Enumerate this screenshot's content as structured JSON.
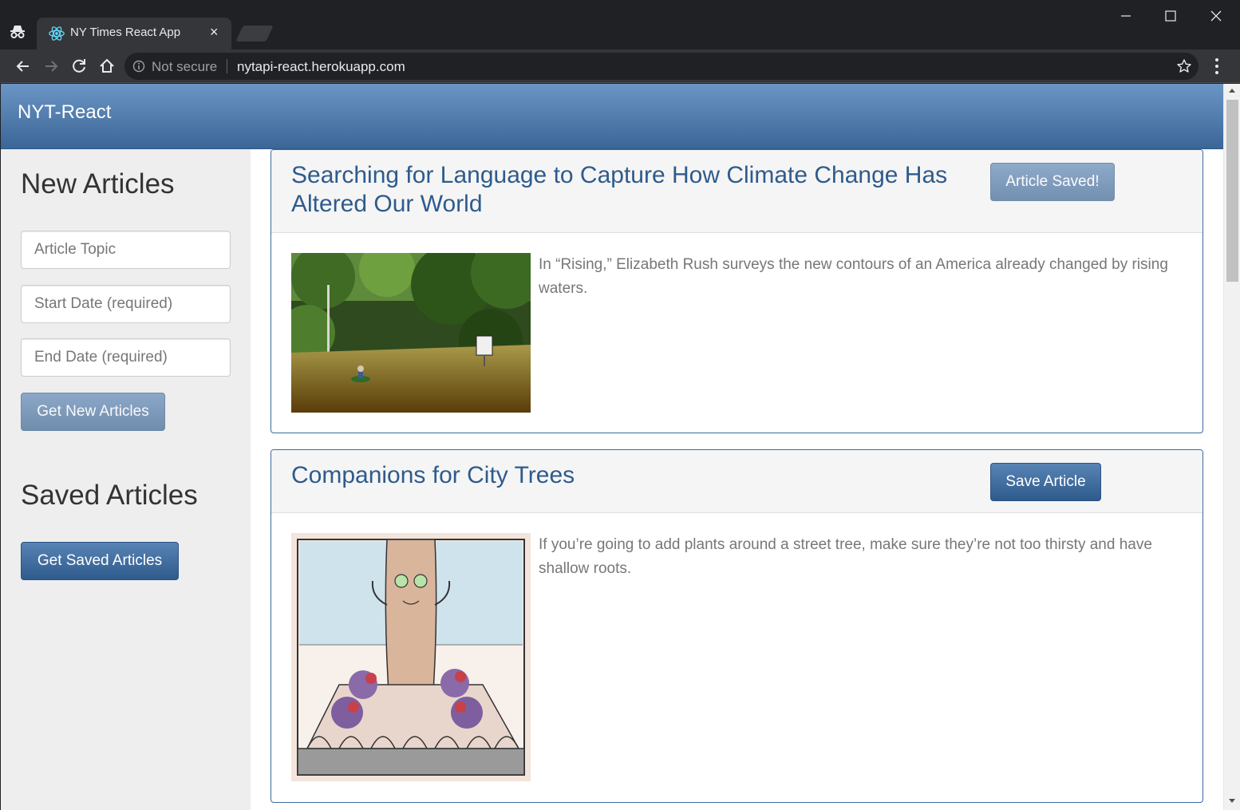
{
  "browser": {
    "tab_title": "NY Times React App",
    "tab_close": "×",
    "security_label": "Not secure",
    "url": "nytapi-react.herokuapp.com"
  },
  "app": {
    "brand": "NYT-React"
  },
  "sidebar": {
    "new_heading": "New Articles",
    "topic_placeholder": "Article Topic",
    "start_placeholder": "Start Date (required)",
    "end_placeholder": "End Date (required)",
    "get_new_label": "Get New Articles",
    "saved_heading": "Saved Articles",
    "get_saved_label": "Get Saved Articles"
  },
  "articles": [
    {
      "title": "Searching for Language to Capture How Climate Change Has Altered Our World",
      "button_label": "Article Saved!",
      "summary": "In “Rising,” Elizabeth Rush surveys the new contours of an America already changed by rising waters."
    },
    {
      "title": "Companions for City Trees",
      "button_label": "Save Article",
      "summary": "If you’re going to add plants around a street tree, make sure they’re not too thirsty and have shallow roots."
    }
  ],
  "colors": {
    "navbar": "#3b6697",
    "link": "#2e5b8c",
    "sidebar_bg": "#eeeeee"
  }
}
